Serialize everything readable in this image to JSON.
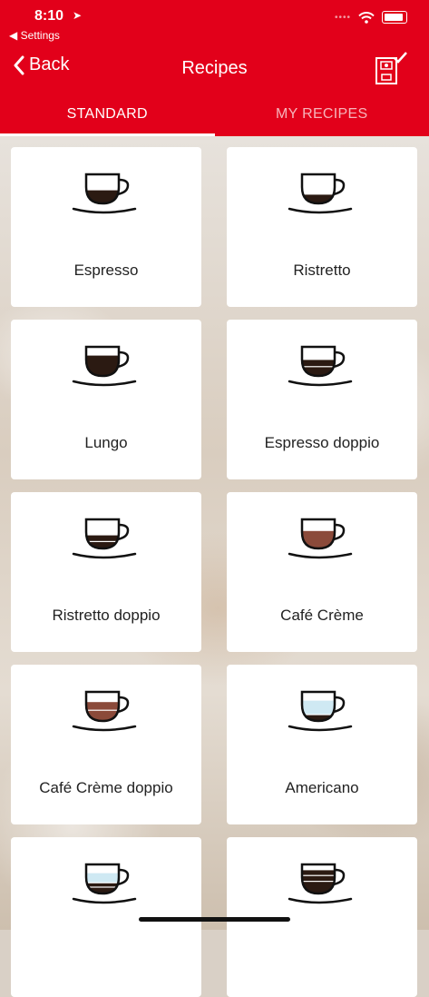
{
  "status_bar": {
    "time": "8:10",
    "back_app": "Settings"
  },
  "nav": {
    "back_label": "Back",
    "title": "Recipes",
    "machine_icon": "coffee-machine-check-icon"
  },
  "tabs": [
    {
      "label": "STANDARD",
      "active": true
    },
    {
      "label": "MY RECIPES",
      "active": false
    }
  ],
  "colors": {
    "brand_red": "#e2001a",
    "espresso": "#2b1a12",
    "creme": "#8b4a3a",
    "water": "#cfe9f3"
  },
  "recipes": [
    {
      "name": "Espresso",
      "cup": "espresso-cup-icon"
    },
    {
      "name": "Ristretto",
      "cup": "ristretto-cup-icon"
    },
    {
      "name": "Lungo",
      "cup": "lungo-cup-icon"
    },
    {
      "name": "Espresso doppio",
      "cup": "espresso-doppio-cup-icon"
    },
    {
      "name": "Ristretto doppio",
      "cup": "ristretto-doppio-cup-icon"
    },
    {
      "name": "Café Crème",
      "cup": "cafe-creme-cup-icon"
    },
    {
      "name": "Café Crème doppio",
      "cup": "cafe-creme-doppio-cup-icon"
    },
    {
      "name": "Americano",
      "cup": "americano-cup-icon"
    },
    {
      "name": "",
      "cup": "americano-doppio-cup-icon"
    },
    {
      "name": "",
      "cup": "layered-cup-icon"
    }
  ]
}
